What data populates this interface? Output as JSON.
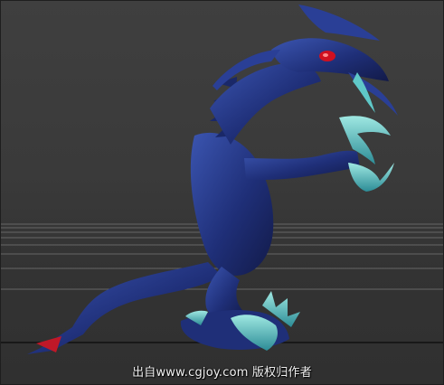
{
  "viewport": {
    "watermark": "出自www.cgjoy.com 版权归作者"
  },
  "colors": {
    "background": "#3a3a3a",
    "grid": "#5e5e5e",
    "creature_body": "#1f2f78",
    "creature_highlight": "#3f5fbf",
    "claw": "#5fc8c8",
    "eye": "#d01020"
  }
}
